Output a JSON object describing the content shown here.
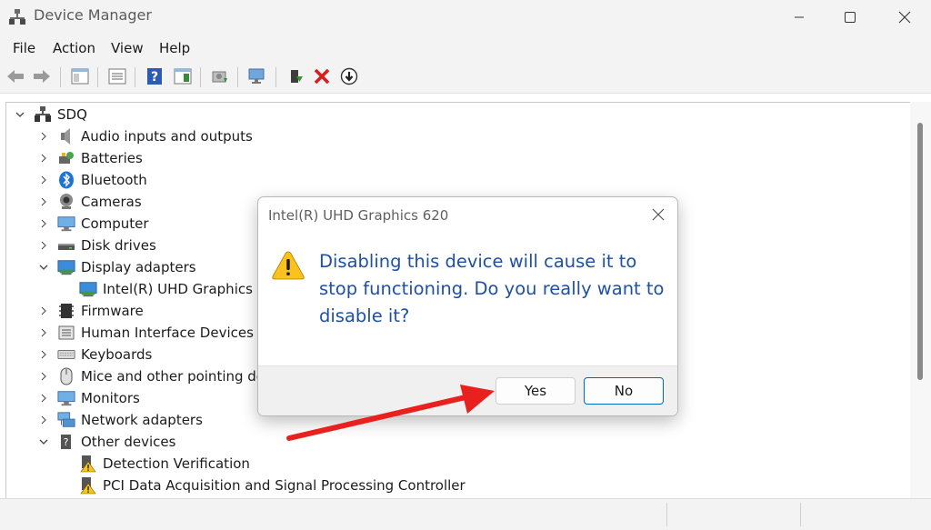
{
  "window": {
    "title": "Device Manager",
    "controls": [
      "minimize",
      "maximize",
      "close"
    ]
  },
  "menubar": {
    "items": [
      {
        "label": "File"
      },
      {
        "label": "Action"
      },
      {
        "label": "View"
      },
      {
        "label": "Help"
      }
    ]
  },
  "toolbar": {
    "buttons": [
      {
        "icon": "back-arrow-icon"
      },
      {
        "icon": "forward-arrow-icon"
      },
      {
        "icon": "show-hide-console-tree-icon"
      },
      {
        "icon": "properties-icon"
      },
      {
        "icon": "help-icon"
      },
      {
        "icon": "action-pane-icon"
      },
      {
        "icon": "update-driver-icon"
      },
      {
        "icon": "scan-hardware-icon"
      },
      {
        "icon": "enable-device-icon"
      },
      {
        "icon": "uninstall-device-icon"
      },
      {
        "icon": "disable-device-icon"
      }
    ]
  },
  "tree": {
    "root": {
      "label": "SDQ",
      "icon": "computer-network-icon"
    },
    "items": [
      {
        "label": "Audio inputs and outputs",
        "icon": "speaker-icon",
        "expanded": false,
        "level": 1
      },
      {
        "label": "Batteries",
        "icon": "battery-icon",
        "expanded": false,
        "level": 1
      },
      {
        "label": "Bluetooth",
        "icon": "bluetooth-icon",
        "expanded": false,
        "level": 1
      },
      {
        "label": "Cameras",
        "icon": "camera-icon",
        "expanded": false,
        "level": 1
      },
      {
        "label": "Computer",
        "icon": "monitor-icon",
        "expanded": false,
        "level": 1
      },
      {
        "label": "Disk drives",
        "icon": "disk-drive-icon",
        "expanded": false,
        "level": 1
      },
      {
        "label": "Display adapters",
        "icon": "display-adapter-icon",
        "expanded": true,
        "level": 1
      },
      {
        "label": "Intel(R) UHD Graphics 620",
        "icon": "display-adapter-icon",
        "level": 2
      },
      {
        "label": "Firmware",
        "icon": "firmware-icon",
        "expanded": false,
        "level": 1
      },
      {
        "label": "Human Interface Devices",
        "icon": "hid-icon",
        "expanded": false,
        "level": 1
      },
      {
        "label": "Keyboards",
        "icon": "keyboard-icon",
        "expanded": false,
        "level": 1
      },
      {
        "label": "Mice and other pointing devices",
        "icon": "mouse-icon",
        "expanded": false,
        "level": 1
      },
      {
        "label": "Monitors",
        "icon": "monitor-icon",
        "expanded": false,
        "level": 1
      },
      {
        "label": "Network adapters",
        "icon": "network-adapter-icon",
        "expanded": false,
        "level": 1
      },
      {
        "label": "Other devices",
        "icon": "unknown-device-icon",
        "expanded": true,
        "level": 1
      },
      {
        "label": "Detection Verification",
        "icon": "warning-device-icon",
        "level": 2
      },
      {
        "label": "PCI Data Acquisition and Signal Processing Controller",
        "icon": "warning-device-icon",
        "level": 2
      }
    ]
  },
  "dialog": {
    "title": "Intel(R) UHD Graphics 620",
    "message": "Disabling this device will cause it to stop functioning. Do you really want to disable it?",
    "icon": "warning-icon",
    "yes_label": "Yes",
    "no_label": "No"
  },
  "colors": {
    "message_text": "#1f50a5",
    "annotation_arrow": "#e8201e",
    "focus_border": "#0067c0"
  }
}
